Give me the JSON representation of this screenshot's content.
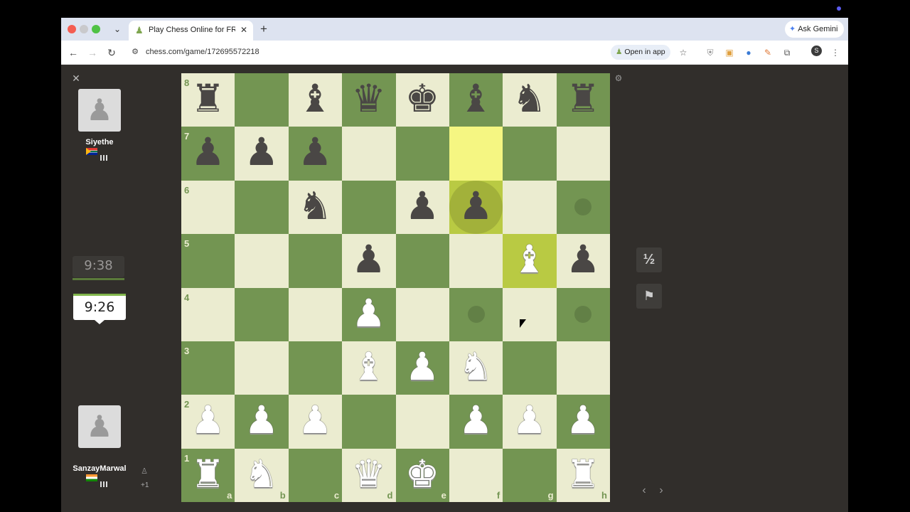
{
  "browser": {
    "tab_title": "Play Chess Online for FREE -",
    "new_tab_symbol": "+",
    "url": "chess.com/game/172695572218",
    "open_in_app_label": "Open in app",
    "ask_gemini_label": "Ask Gemini",
    "profile_initial": "S"
  },
  "players": {
    "opponent": {
      "name": "Siyethe",
      "country": "ZA",
      "clock": "9:38"
    },
    "me": {
      "name": "SanzayMarwal",
      "country": "IN",
      "clock": "9:26"
    }
  },
  "plus_one": "+1",
  "controls": {
    "draw_label": "½"
  },
  "board": {
    "orientation": "white",
    "ranks": [
      "8",
      "7",
      "6",
      "5",
      "4",
      "3",
      "2",
      "1"
    ],
    "files": [
      "a",
      "b",
      "c",
      "d",
      "e",
      "f",
      "g",
      "h"
    ],
    "pieces": [
      [
        "br",
        "",
        "bb",
        "bq",
        "bk",
        "bb",
        "bn",
        "br"
      ],
      [
        "bp",
        "bp",
        "bp",
        "",
        "",
        "",
        "",
        ""
      ],
      [
        "",
        "",
        "bn",
        "",
        "bp",
        "bp",
        "",
        ""
      ],
      [
        "",
        "",
        "",
        "bp",
        "",
        "",
        "wb",
        "bp"
      ],
      [
        "",
        "",
        "",
        "wp",
        "",
        "",
        "",
        ""
      ],
      [
        "",
        "",
        "",
        "wb",
        "wp",
        "wn",
        "",
        ""
      ],
      [
        "wp",
        "wp",
        "wp",
        "",
        "",
        "wp",
        "wp",
        "wp"
      ],
      [
        "wr",
        "wn",
        "",
        "wq",
        "wk",
        "",
        "",
        "wr"
      ]
    ],
    "highlighted_squares": [
      "f7",
      "f6",
      "g5"
    ],
    "selected_square": "f6",
    "legal_move_dots": [
      "h6",
      "f4",
      "h4"
    ],
    "colors": {
      "light": "#ebecd0",
      "dark": "#739552",
      "highlight_light": "#f5f682",
      "highlight_dark": "#b9ca43"
    }
  }
}
